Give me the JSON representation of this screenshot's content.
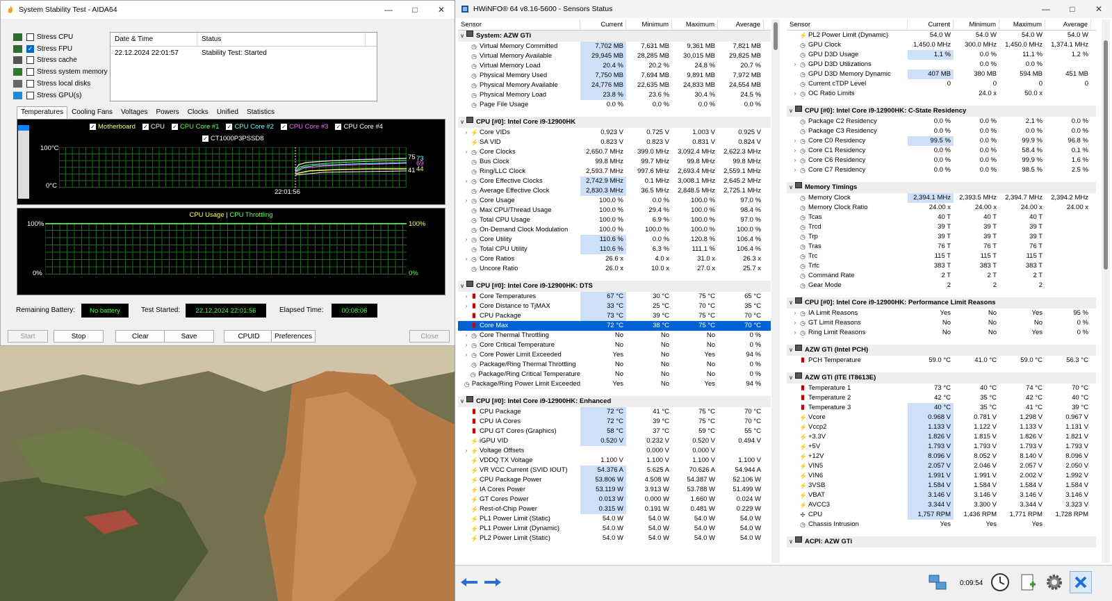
{
  "aida": {
    "title": "System Stability Test - AIDA64",
    "stress_items": [
      {
        "label": "Stress CPU",
        "checked": false
      },
      {
        "label": "Stress FPU",
        "checked": true
      },
      {
        "label": "Stress cache",
        "checked": false
      },
      {
        "label": "Stress system memory",
        "checked": false
      },
      {
        "label": "Stress local disks",
        "checked": false
      },
      {
        "label": "Stress GPU(s)",
        "checked": false
      }
    ],
    "log": {
      "col1": "Date & Time",
      "col2": "Status",
      "rows": [
        {
          "time": "22.12.2024 22:01:57",
          "status": "Stability Test: Started"
        }
      ]
    },
    "tabs": [
      "Temperatures",
      "Cooling Fans",
      "Voltages",
      "Powers",
      "Clocks",
      "Unified",
      "Statistics"
    ],
    "temp_graph": {
      "legend1": [
        {
          "label": "Motherboard",
          "color": "#ffff66"
        },
        {
          "label": "CPU",
          "color": "#ffffff"
        },
        {
          "label": "CPU Core #1",
          "color": "#66ff66"
        },
        {
          "label": "CPU Core #2",
          "color": "#66ffff"
        },
        {
          "label": "CPU Core #3",
          "color": "#ff66ff"
        },
        {
          "label": "CPU Core #4",
          "color": "#ffffff"
        }
      ],
      "legend2": [
        {
          "label": "CT1000P3PSSD8",
          "color": "#ffffff"
        }
      ],
      "y_top": "100°C",
      "y_bottom": "0°C",
      "x_label": "22:01:56",
      "r1": "75",
      "r2": "73",
      "r3": "69",
      "r4": "41",
      "r5": "44"
    },
    "usage_graph": {
      "title1": "CPU Usage",
      "sep": "|",
      "title2": "CPU Throttling",
      "title1_color": "#ffff66",
      "title2_color": "#66ff66",
      "y_top": "100%",
      "y_bottom": "0%",
      "r_top": "100%",
      "r_bottom": "0%"
    },
    "status": {
      "battery_label": "Remaining Battery:",
      "battery_value": "No battery",
      "started_label": "Test Started:",
      "started_value": "22.12.2024 22:01:56",
      "elapsed_label": "Elapsed Time:",
      "elapsed_value": "00:08:06"
    },
    "buttons": {
      "start": "Start",
      "stop": "Stop",
      "clear": "Clear",
      "save": "Save",
      "cpuid": "CPUID",
      "preferences": "Preferences",
      "close": "Close"
    }
  },
  "hwinfo": {
    "title": "HWiNFO® 64 v8.16-5600 - Sensors Status",
    "headers": {
      "sensor": "Sensor",
      "current": "Current",
      "minimum": "Minimum",
      "maximum": "Maximum",
      "average": "Average"
    },
    "time": "0:09:54",
    "left": [
      {
        "t": "g",
        "n": "System: AZW GTi"
      },
      {
        "i": "clock",
        "n": "Virtual Memory Committed",
        "c": "7,702 MB",
        "mi": "7,631 MB",
        "ma": "9,361 MB",
        "a": "7,821 MB",
        "h": true
      },
      {
        "i": "clock",
        "n": "Virtual Memory Available",
        "c": "29,945 MB",
        "mi": "28,285 MB",
        "ma": "30,015 MB",
        "a": "29,825 MB",
        "h": true
      },
      {
        "i": "clock",
        "n": "Virtual Memory Load",
        "c": "20.4 %",
        "mi": "20.2 %",
        "ma": "24.8 %",
        "a": "20.7 %",
        "h": true
      },
      {
        "i": "clock",
        "n": "Physical Memory Used",
        "c": "7,750 MB",
        "mi": "7,694 MB",
        "ma": "9,891 MB",
        "a": "7,972 MB",
        "h": true
      },
      {
        "i": "clock",
        "n": "Physical Memory Available",
        "c": "24,776 MB",
        "mi": "22,635 MB",
        "ma": "24,833 MB",
        "a": "24,554 MB",
        "h": true
      },
      {
        "i": "clock",
        "n": "Physical Memory Load",
        "c": "23.8 %",
        "mi": "23.6 %",
        "ma": "30.4 %",
        "a": "24.5 %",
        "h": true
      },
      {
        "i": "clock",
        "n": "Page File Usage",
        "c": "0.0 %",
        "mi": "0.0 %",
        "ma": "0.0 %",
        "a": "0.0 %"
      },
      {
        "t": "s"
      },
      {
        "t": "g",
        "n": "CPU [#0]: Intel Core i9-12900HK"
      },
      {
        "e": true,
        "i": "bolt",
        "n": "Core VIDs",
        "c": "0.923 V",
        "mi": "0.725 V",
        "ma": "1.003 V",
        "a": "0.925 V"
      },
      {
        "i": "bolt",
        "n": "SA VID",
        "c": "0.823 V",
        "mi": "0.823 V",
        "ma": "0.831 V",
        "a": "0.824 V"
      },
      {
        "e": true,
        "i": "clock",
        "n": "Core Clocks",
        "c": "2,650.7 MHz",
        "mi": "399.0 MHz",
        "ma": "3,092.4 MHz",
        "a": "2,622.3 MHz"
      },
      {
        "i": "clock",
        "n": "Bus Clock",
        "c": "99.8 MHz",
        "mi": "99.7 MHz",
        "ma": "99.8 MHz",
        "a": "99.8 MHz"
      },
      {
        "i": "clock",
        "n": "Ring/LLC Clock",
        "c": "2,593.7 MHz",
        "mi": "997.6 MHz",
        "ma": "2,693.4 MHz",
        "a": "2,559.1 MHz"
      },
      {
        "e": true,
        "i": "clock",
        "n": "Core Effective Clocks",
        "c": "2,742.9 MHz",
        "mi": "0.1 MHz",
        "ma": "3,008.1 MHz",
        "a": "2,645.2 MHz",
        "h": true
      },
      {
        "i": "clock",
        "n": "Average Effective Clock",
        "c": "2,830.3 MHz",
        "mi": "36.5 MHz",
        "ma": "2,848.5 MHz",
        "a": "2,725.1 MHz",
        "h": true
      },
      {
        "e": true,
        "i": "clock",
        "n": "Core Usage",
        "c": "100.0 %",
        "mi": "0.0 %",
        "ma": "100.0 %",
        "a": "97.0 %"
      },
      {
        "i": "clock",
        "n": "Max CPU/Thread Usage",
        "c": "100.0 %",
        "mi": "29.4 %",
        "ma": "100.0 %",
        "a": "98.4 %"
      },
      {
        "i": "clock",
        "n": "Total CPU Usage",
        "c": "100.0 %",
        "mi": "6.9 %",
        "ma": "100.0 %",
        "a": "97.0 %"
      },
      {
        "i": "clock",
        "n": "On-Demand Clock Modulation",
        "c": "100.0 %",
        "mi": "100.0 %",
        "ma": "100.0 %",
        "a": "100.0 %"
      },
      {
        "e": true,
        "i": "clock",
        "n": "Core Utility",
        "c": "110.6 %",
        "mi": "0.0 %",
        "ma": "120.8 %",
        "a": "106.4 %",
        "h": true
      },
      {
        "i": "clock",
        "n": "Total CPU Utility",
        "c": "110.6 %",
        "mi": "6.3 %",
        "ma": "111.1 %",
        "a": "106.4 %",
        "h": true
      },
      {
        "e": true,
        "i": "clock",
        "n": "Core Ratios",
        "c": "26.6 x",
        "mi": "4.0 x",
        "ma": "31.0 x",
        "a": "26.3 x"
      },
      {
        "i": "clock",
        "n": "Uncore Ratio",
        "c": "26.0 x",
        "mi": "10.0 x",
        "ma": "27.0 x",
        "a": "25.7 x"
      },
      {
        "t": "s"
      },
      {
        "t": "g",
        "n": "CPU [#0]: Intel Core i9-12900HK: DTS"
      },
      {
        "e": true,
        "i": "therm",
        "n": "Core Temperatures",
        "c": "67 °C",
        "mi": "30 °C",
        "ma": "75 °C",
        "a": "65 °C",
        "h": true
      },
      {
        "e": true,
        "i": "therm",
        "n": "Core Distance to TjMAX",
        "c": "33 °C",
        "mi": "25 °C",
        "ma": "70 °C",
        "a": "35 °C",
        "h": true
      },
      {
        "i": "therm",
        "n": "CPU Package",
        "c": "73 °C",
        "mi": "39 °C",
        "ma": "75 °C",
        "a": "70 °C",
        "h": true
      },
      {
        "i": "therm",
        "n": "Core Max",
        "c": "72 °C",
        "mi": "38 °C",
        "ma": "75 °C",
        "a": "70 °C",
        "sel": true
      },
      {
        "e": true,
        "i": "clock",
        "n": "Core Thermal Throttling",
        "c": "No",
        "mi": "No",
        "ma": "No",
        "a": "0 %"
      },
      {
        "e": true,
        "i": "clock",
        "n": "Core Critical Temperature",
        "c": "No",
        "mi": "No",
        "ma": "No",
        "a": "0 %"
      },
      {
        "e": true,
        "i": "clock",
        "n": "Core Power Limit Exceeded",
        "c": "Yes",
        "mi": "No",
        "ma": "Yes",
        "a": "94 %"
      },
      {
        "i": "clock",
        "n": "Package/Ring Thermal Throttling",
        "c": "No",
        "mi": "No",
        "ma": "No",
        "a": "0 %"
      },
      {
        "i": "clock",
        "n": "Package/Ring Critical Temperature",
        "c": "No",
        "mi": "No",
        "ma": "No",
        "a": "0 %"
      },
      {
        "i": "clock",
        "n": "Package/Ring Power Limit Exceeded",
        "c": "Yes",
        "mi": "No",
        "ma": "Yes",
        "a": "94 %"
      },
      {
        "t": "s"
      },
      {
        "t": "g",
        "n": "CPU [#0]: Intel Core i9-12900HK: Enhanced"
      },
      {
        "i": "therm",
        "n": "CPU Package",
        "c": "72 °C",
        "mi": "41 °C",
        "ma": "75 °C",
        "a": "70 °C",
        "h": true
      },
      {
        "i": "therm",
        "n": "CPU IA Cores",
        "c": "72 °C",
        "mi": "39 °C",
        "ma": "75 °C",
        "a": "70 °C",
        "h": true
      },
      {
        "i": "therm",
        "n": "CPU GT Cores (Graphics)",
        "c": "58 °C",
        "mi": "37 °C",
        "ma": "59 °C",
        "a": "55 °C",
        "h": true
      },
      {
        "i": "bolt",
        "n": "iGPU VID",
        "c": "0.520 V",
        "mi": "0.232 V",
        "ma": "0.520 V",
        "a": "0.494 V",
        "h": true
      },
      {
        "e": true,
        "i": "bolt",
        "n": "Voltage Offsets",
        "c": "",
        "mi": "0.000 V",
        "ma": "0.000 V",
        "a": ""
      },
      {
        "i": "bolt",
        "n": "VDDQ TX Voltage",
        "c": "1.100 V",
        "mi": "1.100 V",
        "ma": "1.100 V",
        "a": "1.100 V"
      },
      {
        "i": "bolt",
        "n": "VR VCC Current (SVID IOUT)",
        "c": "54.376 A",
        "mi": "5.625 A",
        "ma": "70.626 A",
        "a": "54.944 A",
        "h": true
      },
      {
        "i": "bolt",
        "n": "CPU Package Power",
        "c": "53.806 W",
        "mi": "4.508 W",
        "ma": "54.387 W",
        "a": "52.106 W",
        "h": true
      },
      {
        "i": "bolt",
        "n": "IA Cores Power",
        "c": "53.119 W",
        "mi": "3.913 W",
        "ma": "53.788 W",
        "a": "51.499 W",
        "h": true
      },
      {
        "i": "bolt",
        "n": "GT Cores Power",
        "c": "0.013 W",
        "mi": "0.000 W",
        "ma": "1.660 W",
        "a": "0.024 W",
        "h": true
      },
      {
        "i": "bolt",
        "n": "Rest-of-Chip Power",
        "c": "0.315 W",
        "mi": "0.191 W",
        "ma": "0.481 W",
        "a": "0.229 W",
        "h": true
      },
      {
        "i": "bolt",
        "n": "PL1 Power Limit (Static)",
        "c": "54.0 W",
        "mi": "54.0 W",
        "ma": "54.0 W",
        "a": "54.0 W"
      },
      {
        "i": "bolt",
        "n": "PL1 Power Limit (Dynamic)",
        "c": "54.0 W",
        "mi": "54.0 W",
        "ma": "54.0 W",
        "a": "54.0 W"
      },
      {
        "i": "bolt",
        "n": "PL2 Power Limit (Static)",
        "c": "54.0 W",
        "mi": "54.0 W",
        "ma": "54.0 W",
        "a": "54.0 W"
      }
    ],
    "right": [
      {
        "i": "bolt",
        "n": "PL2 Power Limit (Dynamic)",
        "c": "54.0 W",
        "mi": "54.0 W",
        "ma": "54.0 W",
        "a": "54.0 W"
      },
      {
        "i": "clock",
        "n": "GPU Clock",
        "c": "1,450.0 MHz",
        "mi": "300.0 MHz",
        "ma": "1,450.0 MHz",
        "a": "1,374.1 MHz"
      },
      {
        "i": "clock",
        "n": "GPU D3D Usage",
        "c": "1.1 %",
        "mi": "0.0 %",
        "ma": "11.1 %",
        "a": "1.2 %",
        "h": true
      },
      {
        "e": true,
        "i": "clock",
        "n": "GPU D3D Utilizations",
        "c": "",
        "mi": "0.0 %",
        "ma": "0.0 %",
        "a": ""
      },
      {
        "i": "clock",
        "n": "GPU D3D Memory Dynamic",
        "c": "407 MB",
        "mi": "380 MB",
        "ma": "594 MB",
        "a": "451 MB",
        "h": true
      },
      {
        "i": "clock",
        "n": "Current cTDP Level",
        "c": "0",
        "mi": "0",
        "ma": "0",
        "a": "0"
      },
      {
        "e": true,
        "i": "clock",
        "n": "OC Ratio Limits",
        "c": "",
        "mi": "24.0 x",
        "ma": "50.0 x",
        "a": ""
      },
      {
        "t": "s"
      },
      {
        "t": "g",
        "n": "CPU [#0]: Intel Core i9-12900HK: C-State Residency"
      },
      {
        "i": "clock",
        "n": "Package C2 Residency",
        "c": "0.0 %",
        "mi": "0.0 %",
        "ma": "2.1 %",
        "a": "0.0 %"
      },
      {
        "i": "clock",
        "n": "Package C3 Residency",
        "c": "0.0 %",
        "mi": "0.0 %",
        "ma": "0.0 %",
        "a": "0.0 %"
      },
      {
        "e": true,
        "i": "clock",
        "n": "Core C0 Residency",
        "c": "99.5 %",
        "mi": "0.0 %",
        "ma": "99.9 %",
        "a": "96.8 %",
        "h": true
      },
      {
        "e": true,
        "i": "clock",
        "n": "Core C1 Residency",
        "c": "0.0 %",
        "mi": "0.0 %",
        "ma": "58.4 %",
        "a": "0.1 %"
      },
      {
        "e": true,
        "i": "clock",
        "n": "Core C6 Residency",
        "c": "0.0 %",
        "mi": "0.0 %",
        "ma": "99.9 %",
        "a": "1.6 %"
      },
      {
        "e": true,
        "i": "clock",
        "n": "Core C7 Residency",
        "c": "0.0 %",
        "mi": "0.0 %",
        "ma": "98.5 %",
        "a": "2.5 %"
      },
      {
        "t": "s"
      },
      {
        "t": "g",
        "n": "Memory Timings"
      },
      {
        "i": "clock",
        "n": "Memory Clock",
        "c": "2,394.1 MHz",
        "mi": "2,393.5 MHz",
        "ma": "2,394.7 MHz",
        "a": "2,394.2 MHz",
        "h": true
      },
      {
        "i": "clock",
        "n": "Memory Clock Ratio",
        "c": "24.00 x",
        "mi": "24.00 x",
        "ma": "24.00 x",
        "a": "24.00 x"
      },
      {
        "i": "clock",
        "n": "Tcas",
        "c": "40 T",
        "mi": "40 T",
        "ma": "40 T",
        "a": ""
      },
      {
        "i": "clock",
        "n": "Trcd",
        "c": "39 T",
        "mi": "39 T",
        "ma": "39 T",
        "a": ""
      },
      {
        "i": "clock",
        "n": "Trp",
        "c": "39 T",
        "mi": "39 T",
        "ma": "39 T",
        "a": ""
      },
      {
        "i": "clock",
        "n": "Tras",
        "c": "76 T",
        "mi": "76 T",
        "ma": "76 T",
        "a": ""
      },
      {
        "i": "clock",
        "n": "Trc",
        "c": "115 T",
        "mi": "115 T",
        "ma": "115 T",
        "a": ""
      },
      {
        "i": "clock",
        "n": "Trfc",
        "c": "383 T",
        "mi": "383 T",
        "ma": "383 T",
        "a": ""
      },
      {
        "i": "clock",
        "n": "Command Rate",
        "c": "2 T",
        "mi": "2 T",
        "ma": "2 T",
        "a": ""
      },
      {
        "i": "clock",
        "n": "Gear Mode",
        "c": "2",
        "mi": "2",
        "ma": "2",
        "a": ""
      },
      {
        "t": "s"
      },
      {
        "t": "g",
        "n": "CPU [#0]: Intel Core i9-12900HK: Performance Limit Reasons"
      },
      {
        "e": true,
        "i": "clock",
        "n": "IA Limit Reasons",
        "c": "Yes",
        "mi": "No",
        "ma": "Yes",
        "a": "95 %"
      },
      {
        "e": true,
        "i": "clock",
        "n": "GT Limit Reasons",
        "c": "No",
        "mi": "No",
        "ma": "No",
        "a": "0 %"
      },
      {
        "e": true,
        "i": "clock",
        "n": "Ring Limit Reasons",
        "c": "No",
        "mi": "No",
        "ma": "Yes",
        "a": "0 %"
      },
      {
        "t": "s"
      },
      {
        "t": "g",
        "n": "AZW GTi (Intel PCH)"
      },
      {
        "i": "therm",
        "n": "PCH Temperature",
        "c": "59.0 °C",
        "mi": "41.0 °C",
        "ma": "59.0 °C",
        "a": "56.3 °C"
      },
      {
        "t": "s"
      },
      {
        "t": "g",
        "n": "AZW GTi (ITE IT8613E)"
      },
      {
        "i": "therm",
        "n": "Temperature 1",
        "c": "73 °C",
        "mi": "40 °C",
        "ma": "74 °C",
        "a": "70 °C"
      },
      {
        "i": "therm",
        "n": "Temperature 2",
        "c": "42 °C",
        "mi": "35 °C",
        "ma": "42 °C",
        "a": "40 °C"
      },
      {
        "i": "therm",
        "n": "Temperature 3",
        "c": "40 °C",
        "mi": "35 °C",
        "ma": "41 °C",
        "a": "39 °C",
        "h": true
      },
      {
        "i": "bolt",
        "n": "Vcore",
        "c": "0.968 V",
        "mi": "0.781 V",
        "ma": "1.298 V",
        "a": "0.967 V",
        "h": true
      },
      {
        "i": "bolt",
        "n": "Vccp2",
        "c": "1.133 V",
        "mi": "1.122 V",
        "ma": "1.133 V",
        "a": "1.131 V",
        "h": true
      },
      {
        "i": "bolt",
        "n": "+3.3V",
        "c": "1.826 V",
        "mi": "1.815 V",
        "ma": "1.826 V",
        "a": "1.821 V",
        "h": true
      },
      {
        "i": "bolt",
        "n": "+5V",
        "c": "1.793 V",
        "mi": "1.793 V",
        "ma": "1.793 V",
        "a": "1.793 V",
        "h": true
      },
      {
        "i": "bolt",
        "n": "+12V",
        "c": "8.096 V",
        "mi": "8.052 V",
        "ma": "8.140 V",
        "a": "8.096 V",
        "h": true
      },
      {
        "i": "bolt",
        "n": "VIN5",
        "c": "2.057 V",
        "mi": "2.046 V",
        "ma": "2.057 V",
        "a": "2.050 V",
        "h": true
      },
      {
        "i": "bolt",
        "n": "VIN6",
        "c": "1.991 V",
        "mi": "1.991 V",
        "ma": "2.002 V",
        "a": "1.992 V",
        "h": true
      },
      {
        "i": "bolt",
        "n": "3VSB",
        "c": "1.584 V",
        "mi": "1.584 V",
        "ma": "1.584 V",
        "a": "1.584 V",
        "h": true
      },
      {
        "i": "bolt",
        "n": "VBAT",
        "c": "3.146 V",
        "mi": "3.146 V",
        "ma": "3.146 V",
        "a": "3.146 V",
        "h": true
      },
      {
        "i": "bolt",
        "n": "AVCC3",
        "c": "3.344 V",
        "mi": "3.300 V",
        "ma": "3.344 V",
        "a": "3.323 V",
        "h": true
      },
      {
        "i": "fan",
        "n": "CPU",
        "c": "1,757 RPM",
        "mi": "1,436 RPM",
        "ma": "1,771 RPM",
        "a": "1,728 RPM",
        "h": true
      },
      {
        "i": "clock",
        "n": "Chassis Intrusion",
        "c": "Yes",
        "mi": "Yes",
        "ma": "Yes",
        "a": ""
      },
      {
        "t": "s"
      },
      {
        "t": "g",
        "n": "ACPI: AZW GTi"
      }
    ]
  }
}
